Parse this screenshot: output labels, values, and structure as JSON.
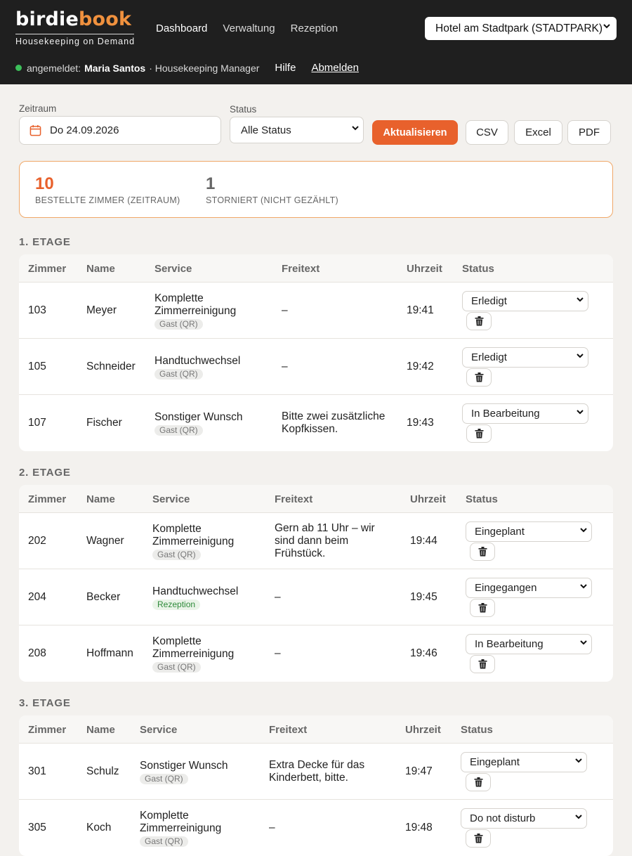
{
  "header": {
    "logo_part1": "birdie",
    "logo_part2": "book",
    "tagline": "Housekeeping on Demand",
    "nav": [
      "Dashboard",
      "Verwaltung",
      "Rezeption"
    ],
    "hotel_select": "Hotel am Stadtpark (STADTPARK)",
    "status_dot_color": "#3cbf5a",
    "logged_in_label": "angemeldet:",
    "user_name": "Maria Santos",
    "user_role": "· Housekeeping Manager",
    "help_link": "Hilfe",
    "logout_link": "Abmelden"
  },
  "filters": {
    "period_label": "Zeitraum",
    "period_value": "Do 24.09.2026",
    "period_icon": "calendar-icon",
    "status_label": "Status",
    "status_value": "Alle Status",
    "refresh_button": "Aktualisieren",
    "csv_button": "CSV",
    "excel_button": "Excel",
    "pdf_button": "PDF"
  },
  "stats": {
    "ordered_count": "10",
    "ordered_label": "BESTELLTE ZIMMER (ZEITRAUM)",
    "cancelled_count": "1",
    "cancelled_label": "STORNIERT (NICHT GEZÄHLT)"
  },
  "columns": [
    "Zimmer",
    "Name",
    "Service",
    "Freitext",
    "Uhrzeit",
    "Status"
  ],
  "floors": [
    {
      "title": "1. ETAGE",
      "rows": [
        {
          "room": "103",
          "name": "Meyer",
          "service": [
            "Komplette",
            "Zimmerreinigung"
          ],
          "source": "Gast (QR)",
          "note": [
            "–"
          ],
          "time": "19:41",
          "status": "Erledigt"
        },
        {
          "room": "105",
          "name": "Schneider",
          "service": [
            "Handtuchwechsel"
          ],
          "source": "Gast (QR)",
          "note": [
            "–"
          ],
          "time": "19:42",
          "status": "Erledigt"
        },
        {
          "room": "107",
          "name": "Fischer",
          "service": [
            "Sonstiger Wunsch"
          ],
          "source": "Gast (QR)",
          "note": [
            "Bitte zwei zusätzliche",
            "Kopfkissen."
          ],
          "time": "19:43",
          "status": "In Bearbeitung"
        }
      ]
    },
    {
      "title": "2. ETAGE",
      "rows": [
        {
          "room": "202",
          "name": "Wagner",
          "service": [
            "Komplette",
            "Zimmerreinigung"
          ],
          "source": "Gast (QR)",
          "note": [
            "Gern ab 11 Uhr – wir",
            "sind dann beim",
            "Frühstück."
          ],
          "time": "19:44",
          "status": "Eingeplant"
        },
        {
          "room": "204",
          "name": "Becker",
          "service": [
            "Handtuchwechsel"
          ],
          "source": "Rezeption",
          "note": [
            "–"
          ],
          "time": "19:45",
          "status": "Eingegangen"
        },
        {
          "room": "208",
          "name": "Hoffmann",
          "service": [
            "Komplette",
            "Zimmerreinigung"
          ],
          "source": "Gast (QR)",
          "note": [
            "–"
          ],
          "time": "19:46",
          "status": "In Bearbeitung"
        }
      ]
    },
    {
      "title": "3. ETAGE",
      "rows": [
        {
          "room": "301",
          "name": "Schulz",
          "service": [
            "Sonstiger Wunsch"
          ],
          "source": "Gast (QR)",
          "note": [
            "Extra Decke für das",
            "Kinderbett, bitte."
          ],
          "time": "19:47",
          "status": "Eingeplant"
        },
        {
          "room": "305",
          "name": "Koch",
          "service": [
            "Komplette",
            "Zimmerreinigung"
          ],
          "source": "Gast (QR)",
          "note": [
            "–"
          ],
          "time": "19:48",
          "status": "Do not disturb"
        }
      ]
    }
  ]
}
